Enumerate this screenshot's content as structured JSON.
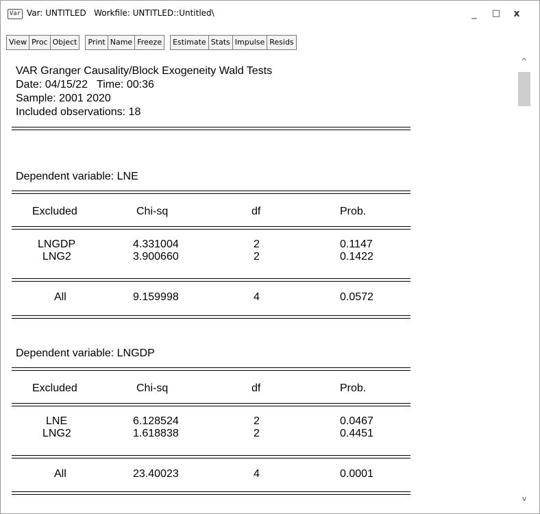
{
  "window": {
    "icon_label": "Var",
    "title": "Var: UNTITLED   Workfile: UNTITLED::Untitled\\",
    "minimize": "_",
    "maximize": "□",
    "close": "x"
  },
  "toolbar": {
    "groups": [
      [
        "View",
        "Proc",
        "Object"
      ],
      [
        "Print",
        "Name",
        "Freeze"
      ],
      [
        "Estimate",
        "Stats",
        "Impulse",
        "Resids"
      ]
    ]
  },
  "report": {
    "heading": "VAR Granger Causality/Block Exogeneity Wald Tests",
    "date_line": "Date: 04/15/22   Time: 00:36",
    "sample_line": "Sample: 2001 2020",
    "obs_line": "Included observations: 18",
    "columns": [
      "Excluded",
      "Chi-sq",
      "df",
      "Prob."
    ],
    "blocks": [
      {
        "dependent": "Dependent variable: LNE",
        "rows": [
          [
            "LNGDP",
            "4.331004",
            "2",
            "0.1147"
          ],
          [
            "LNG2",
            "3.900660",
            "2",
            "0.1422"
          ]
        ],
        "total": [
          "All",
          "9.159998",
          "4",
          "0.0572"
        ]
      },
      {
        "dependent": "Dependent variable: LNGDP",
        "rows": [
          [
            "LNE",
            "6.128524",
            "2",
            "0.0467"
          ],
          [
            "LNG2",
            "1.618838",
            "2",
            "0.4451"
          ]
        ],
        "total": [
          "All",
          "23.40023",
          "4",
          "0.0001"
        ]
      }
    ]
  },
  "scrollbar": {
    "up": "^",
    "down": "v"
  }
}
